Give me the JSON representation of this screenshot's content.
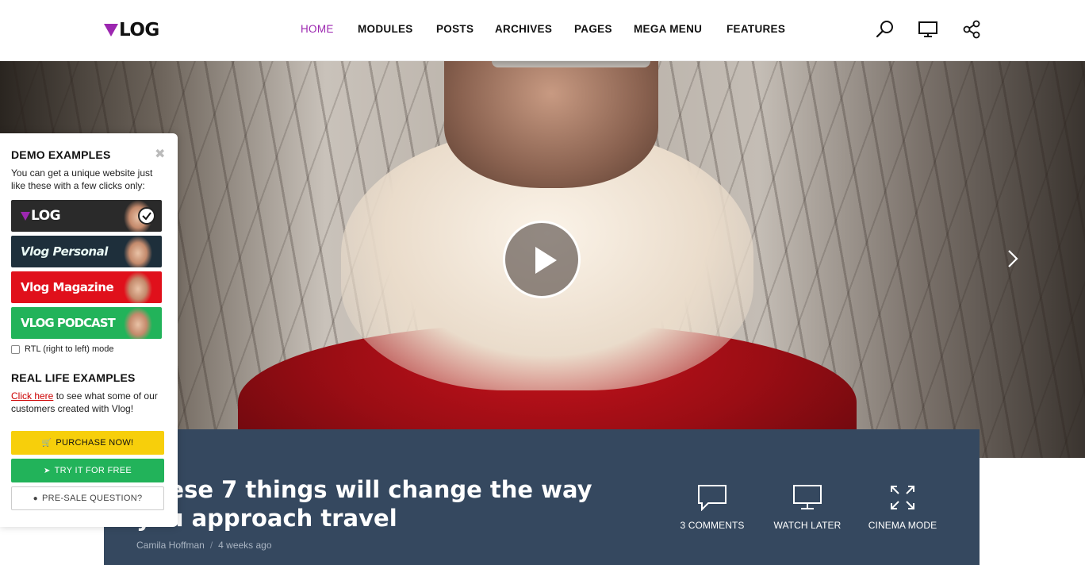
{
  "header": {
    "logo_text": "LOG",
    "nav": [
      "HOME",
      "MODULES",
      "POSTS",
      "ARCHIVES",
      "PAGES",
      "MEGA MENU",
      "FEATURES"
    ],
    "icons": [
      "search-icon",
      "monitor-icon",
      "share-icon"
    ],
    "accent": "#9c27b0"
  },
  "hero": {
    "play_icon": "play-icon",
    "next_icon": "chevron-right-icon"
  },
  "post": {
    "title": "These 7 things will change the way you approach travel",
    "author": "Camila Hoffman",
    "separator": "/",
    "date": "4 weeks ago",
    "actions": [
      {
        "label": "3 COMMENTS",
        "icon": "comment-icon"
      },
      {
        "label": "WATCH LATER",
        "icon": "monitor-icon"
      },
      {
        "label": "CINEMA MODE",
        "icon": "expand-icon"
      }
    ],
    "bar_color": "#35485f"
  },
  "panel": {
    "title": "DEMO EXAMPLES",
    "intro": "You can get a unique website just like these with a few clicks only:",
    "demos": [
      {
        "label": "LOG",
        "color": "#2a2a2a"
      },
      {
        "label": "Vlog Personal",
        "color": "#1e2f3b"
      },
      {
        "label": "Vlog Magazine",
        "color": "#e0101b"
      },
      {
        "label": "VLOG PODCAST",
        "color": "#22b35a"
      }
    ],
    "rtl_label": "RTL (right to left) mode",
    "real_title": "REAL LIFE EXAMPLES",
    "link_text": "Click here",
    "link_rest": " to see what some of our customers created with Vlog!",
    "purchase": "PURCHASE NOW!",
    "try": "TRY IT FOR FREE",
    "question": "PRE-SALE QUESTION?"
  }
}
